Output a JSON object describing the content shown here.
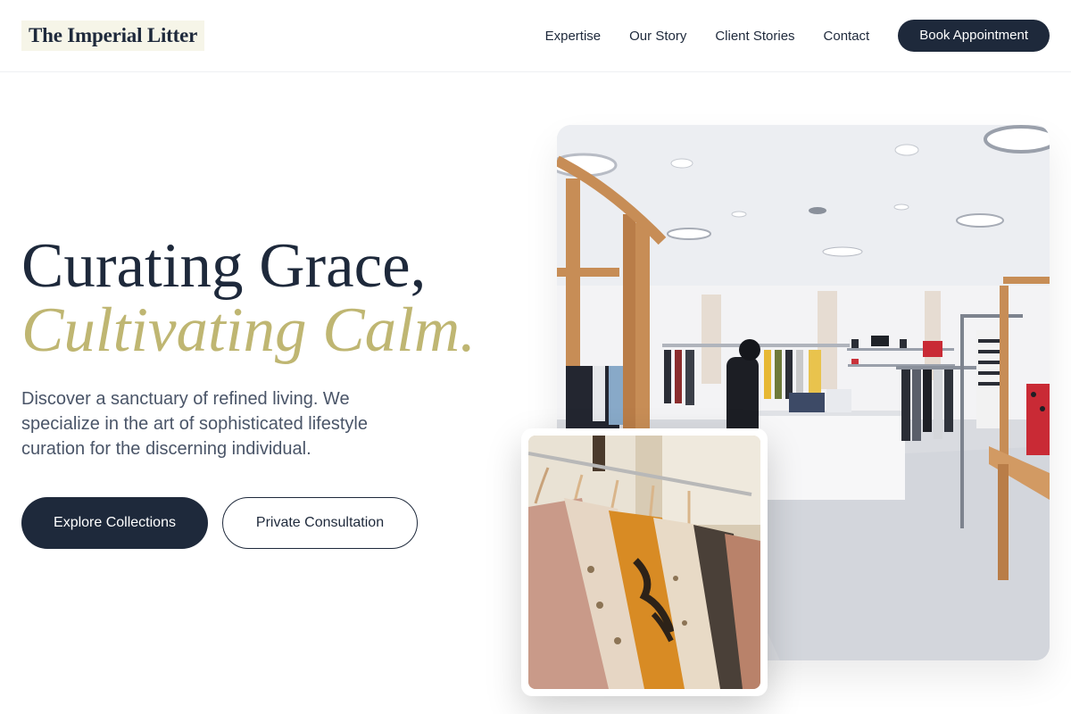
{
  "header": {
    "logo": "The Imperial Litter",
    "nav": [
      "Expertise",
      "Our Story",
      "Client Stories",
      "Contact"
    ],
    "cta": "Book Appointment"
  },
  "hero": {
    "title_line1": "Curating Grace,",
    "title_line2": "Cultivating Calm.",
    "description": "Discover a sanctuary of refined living. We specialize in the art of sophisticated lifestyle curation for the discerning individual.",
    "primary_button": "Explore Collections",
    "secondary_button": "Private Consultation"
  },
  "colors": {
    "navy": "#1e293b",
    "gold_accent": "#bfb672",
    "logo_highlight": "#f6f5e8",
    "text_muted": "#4a5568"
  },
  "images": {
    "main": "boutique-interior-photo",
    "inset": "clothing-rack-photo"
  }
}
